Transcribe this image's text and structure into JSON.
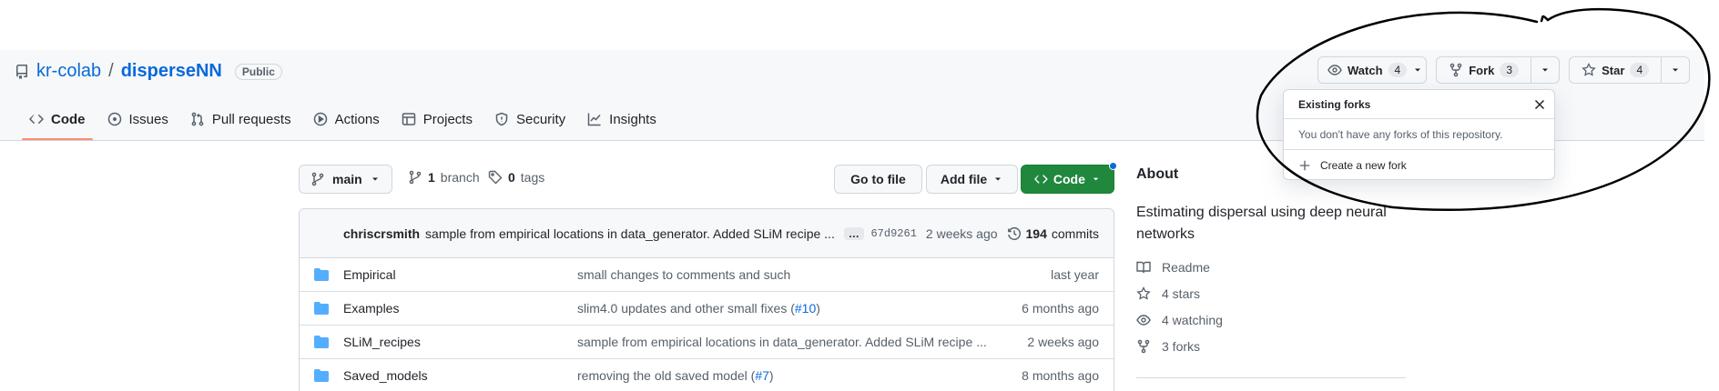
{
  "repo": {
    "owner": "kr-colab",
    "separator": "/",
    "name": "disperseNN",
    "visibility": "Public"
  },
  "tabs": [
    {
      "label": "Code",
      "icon": "code-icon"
    },
    {
      "label": "Issues",
      "icon": "issue-icon"
    },
    {
      "label": "Pull requests",
      "icon": "pull-request-icon"
    },
    {
      "label": "Actions",
      "icon": "play-icon"
    },
    {
      "label": "Projects",
      "icon": "table-icon"
    },
    {
      "label": "Security",
      "icon": "shield-icon"
    },
    {
      "label": "Insights",
      "icon": "graph-icon"
    }
  ],
  "header_actions": {
    "watch": {
      "label": "Watch",
      "count": "4"
    },
    "fork": {
      "label": "Fork",
      "count": "3"
    },
    "star": {
      "label": "Star",
      "count": "4"
    }
  },
  "fork_popover": {
    "title": "Existing forks",
    "message": "You don't have any forks of this repository.",
    "create_label": "Create a new fork"
  },
  "toolbar": {
    "branch": "main",
    "branch_count": "1",
    "branch_word": "branch",
    "tag_count": "0",
    "tag_word": "tags",
    "go_to_file": "Go to file",
    "add_file": "Add file",
    "code": "Code"
  },
  "latest_commit": {
    "author": "chriscrsmith",
    "message": "sample from empirical locations in data_generator. Added SLiM recipe ...",
    "ellipsis": "…",
    "sha": "67d9261",
    "time": "2 weeks ago",
    "commit_count": "194",
    "commit_word": "commits"
  },
  "files": [
    {
      "name": "Empirical",
      "message": "small changes to comments and such",
      "pr": "",
      "after": "",
      "date": "last year"
    },
    {
      "name": "Examples",
      "message": "slim4.0 updates and other small fixes (",
      "pr": "#10",
      "after": ")",
      "date": "6 months ago"
    },
    {
      "name": "SLiM_recipes",
      "message": "sample from empirical locations in data_generator. Added SLiM recipe ...",
      "pr": "",
      "after": "",
      "date": "2 weeks ago"
    },
    {
      "name": "Saved_models",
      "message": "removing the old saved model (",
      "pr": "#7",
      "after": ")",
      "date": "8 months ago"
    }
  ],
  "about": {
    "title": "About",
    "description": "Estimating dispersal using deep neural networks",
    "readme": "Readme",
    "stars": "4 stars",
    "watching": "4 watching",
    "forks": "3 forks"
  },
  "colors": {
    "accent": "#0969da",
    "green": "#1f883d",
    "tab_underline": "#fd8c73",
    "folder": "#54aeff"
  }
}
